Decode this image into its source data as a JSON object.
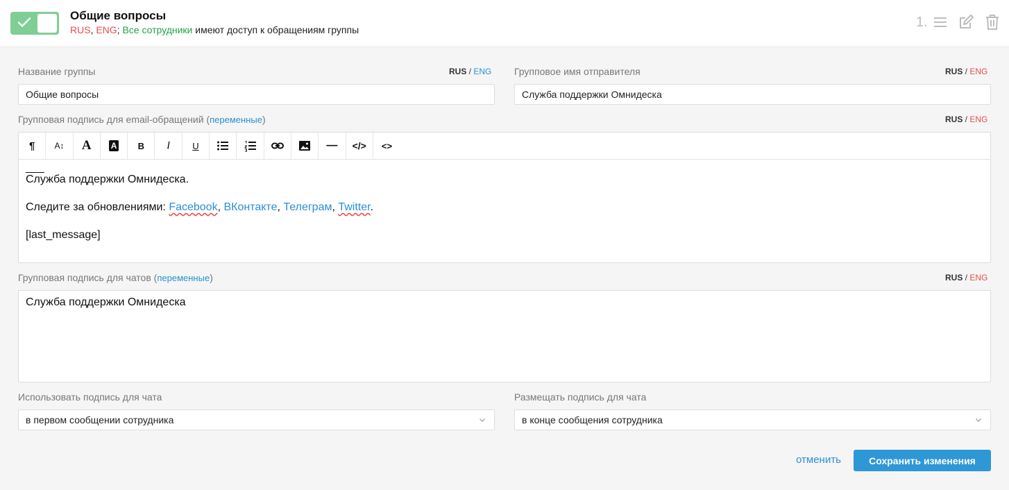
{
  "header": {
    "title": "Общие вопросы",
    "sub_rus": "RUS",
    "sub_comma": ", ",
    "sub_eng": "ENG",
    "sub_semicolon": "; ",
    "sub_staff": "Все сотрудники",
    "sub_rest": " имеют доступ к обращениям группы",
    "order_number": "1.",
    "toggle_on": true
  },
  "lang_switch": {
    "rus": "RUS",
    "sep": " / ",
    "eng": "ENG"
  },
  "group_name": {
    "label": "Название группы",
    "value": "Общие вопросы"
  },
  "sender_name": {
    "label": "Групповое имя отправителя",
    "value": "Служба поддержки Омнидеска"
  },
  "email_signature": {
    "label": "Групповая подпись для email-обращений (",
    "vars_link": "переменные",
    "label_end": ")",
    "toolbar": [
      {
        "name": "paragraph-icon",
        "glyph": "¶"
      },
      {
        "name": "font-size-icon",
        "glyph": "A↕"
      },
      {
        "name": "font-color-icon",
        "glyph": "A"
      },
      {
        "name": "background-color-icon",
        "glyph": "A"
      },
      {
        "name": "bold-icon",
        "glyph": "B"
      },
      {
        "name": "italic-icon",
        "glyph": "I"
      },
      {
        "name": "underline-icon",
        "glyph": "U"
      },
      {
        "name": "bullet-list-icon",
        "glyph": ""
      },
      {
        "name": "numbered-list-icon",
        "glyph": ""
      },
      {
        "name": "link-icon",
        "glyph": ""
      },
      {
        "name": "image-icon",
        "glyph": ""
      },
      {
        "name": "horizontal-rule-icon",
        "glyph": "—"
      },
      {
        "name": "code-icon",
        "glyph": "</>"
      },
      {
        "name": "html-source-icon",
        "glyph": "<>"
      }
    ],
    "body": {
      "dash": "___",
      "line1": "Служба поддержки Омнидеска.",
      "follow": "Следите за обновлениями: ",
      "links": [
        "Facebook",
        "ВКонтакте",
        "Телеграм",
        "Twitter"
      ],
      "comma": ", ",
      "period": ".",
      "last": "[last_message]"
    }
  },
  "chat_signature": {
    "label": "Групповая подпись для чатов (",
    "vars_link": "переменные",
    "label_end": ")",
    "value": "Служба поддержки Омнидеска"
  },
  "use_signature": {
    "label": "Использовать подпись для чата",
    "selected": "в первом сообщении сотрудника"
  },
  "place_signature": {
    "label": "Размещать подпись для чата",
    "selected": "в конце сообщения сотрудника"
  },
  "actions": {
    "cancel": "отменить",
    "save": "Сохранить изменения"
  },
  "colors": {
    "toggle": "#7fce95",
    "accent": "#2e97d6",
    "red": "#e3504f",
    "green": "#22a34a"
  }
}
